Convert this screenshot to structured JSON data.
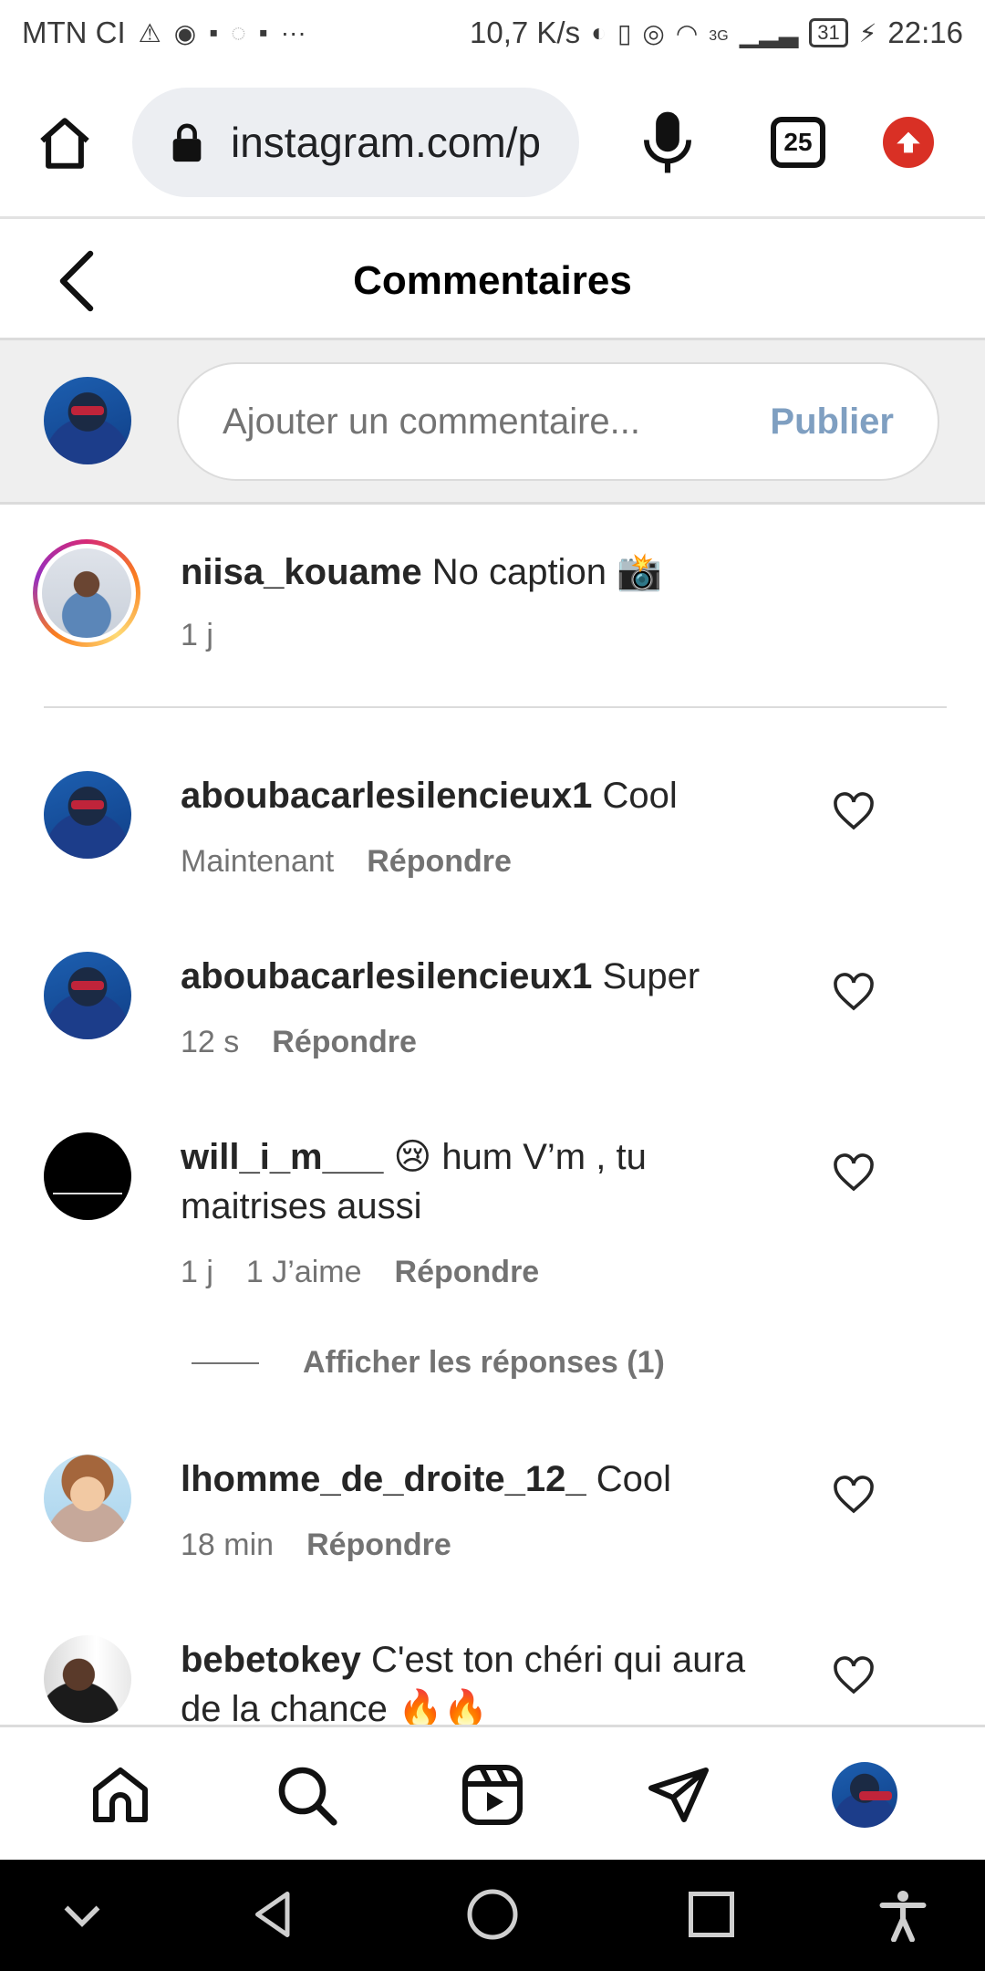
{
  "status_bar": {
    "carrier": "MTN CI",
    "speed": "10,7 K/s",
    "network": "3G",
    "battery": "31",
    "time": "22:16",
    "overflow": "···"
  },
  "browser": {
    "url": "instagram.com/p",
    "tab_count": "25"
  },
  "header": {
    "title": "Commentaires"
  },
  "composer": {
    "placeholder": "Ajouter un commentaire...",
    "publish_label": "Publier"
  },
  "caption": {
    "username": "niisa_kouame",
    "text": "No caption 📸",
    "time": "1 j"
  },
  "comments": [
    {
      "username": "aboubacarlesilencieux1",
      "text": "Cool",
      "time": "Maintenant",
      "likes": "",
      "reply": "Répondre"
    },
    {
      "username": "aboubacarlesilencieux1",
      "text": "Super",
      "time": "12 s",
      "likes": "",
      "reply": "Répondre"
    },
    {
      "username": "will_i_m___",
      "text": "😢 hum V’m , tu maitrises aussi",
      "time": "1 j",
      "likes": "1 J’aime",
      "reply": "Répondre"
    },
    {
      "username": "lhomme_de_droite_12_",
      "text": "Cool",
      "time": "18 min",
      "likes": "",
      "reply": "Répondre"
    },
    {
      "username": "bebetokey",
      "text": "C'est ton chéri qui aura de la chance 🔥🔥",
      "time": "",
      "likes": "",
      "reply": ""
    }
  ],
  "view_replies": "Afficher les réponses (1)",
  "colors": {
    "publish": "#7f9fc1",
    "meta_text": "#737373",
    "update_badge": "#d93025"
  }
}
